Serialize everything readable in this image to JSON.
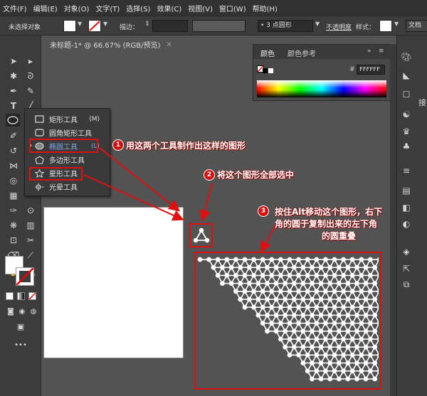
{
  "menubar": {
    "items": [
      "文件(F)",
      "编辑(E)",
      "对象(O)",
      "文字(T)",
      "选择(S)",
      "效果(C)",
      "视图(V)",
      "窗口(W)",
      "帮助(H)"
    ]
  },
  "controlbar": {
    "no_selection": "未选择对象",
    "stroke_label": "描边：",
    "brush": "3 点圆形",
    "opacity_label": "不透明度",
    "style_label": "样式：",
    "doc_button": "文档"
  },
  "document": {
    "tab_title": "未标题-1* @ 66.67% (RGB/预览)"
  },
  "color_panel": {
    "tab_color": "颜色",
    "tab_guide": "颜色参考",
    "hash": "#",
    "hex": "FFFFFF",
    "expand_icon": "double-chevron-right-icon",
    "menu_icon": "panel-menu-icon"
  },
  "flyout": {
    "items": [
      {
        "label": "矩形工具",
        "shortcut": "(M)"
      },
      {
        "label": "圆角矩形工具",
        "shortcut": ""
      },
      {
        "label": "椭圆工具",
        "shortcut": "(L)"
      },
      {
        "label": "多边形工具",
        "shortcut": ""
      },
      {
        "label": "星形工具",
        "shortcut": ""
      },
      {
        "label": "光晕工具",
        "shortcut": ""
      }
    ]
  },
  "annotations": {
    "step1_num": "1",
    "step1_text": "用这两个工具制作出这样的图形",
    "step2_num": "2",
    "step2_text": "将这个图形全部选中",
    "step3_num": "3",
    "step3_line1": "按住Alt移动这个图形，右下",
    "step3_line2": "角的圆于复制出来的左下角",
    "step3_line3": "的圆重叠"
  },
  "right_dock": {
    "side_label": "接"
  },
  "colors": {
    "annotation_red": "#e01010",
    "badge_red": "#d41111",
    "highlight_blue": "#7aa7e6"
  }
}
